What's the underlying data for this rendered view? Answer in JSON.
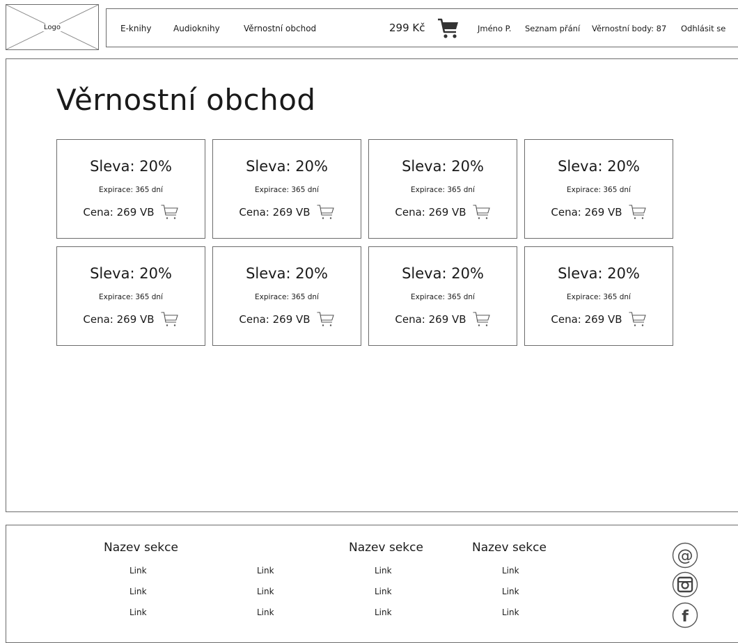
{
  "header": {
    "logo_label": "Logo",
    "nav": [
      "E-knihy",
      "Audioknihy",
      "Věrnostní obchod"
    ],
    "cart_total": "299 Kč",
    "user_name": "Jméno P.",
    "wishlist": "Seznam přání",
    "loyalty_points": "Věrnostní body: 87",
    "logout": "Odhlásit se"
  },
  "main": {
    "title": "Věrnostní obchod",
    "cards": [
      {
        "discount": "Sleva: 20%",
        "expiry": "Expirace: 365 dní",
        "price": "Cena: 269 VB"
      },
      {
        "discount": "Sleva: 20%",
        "expiry": "Expirace: 365 dní",
        "price": "Cena: 269 VB"
      },
      {
        "discount": "Sleva: 20%",
        "expiry": "Expirace: 365 dní",
        "price": "Cena: 269 VB"
      },
      {
        "discount": "Sleva: 20%",
        "expiry": "Expirace: 365 dní",
        "price": "Cena: 269 VB"
      },
      {
        "discount": "Sleva: 20%",
        "expiry": "Expirace: 365 dní",
        "price": "Cena: 269 VB"
      },
      {
        "discount": "Sleva: 20%",
        "expiry": "Expirace: 365 dní",
        "price": "Cena: 269 VB"
      },
      {
        "discount": "Sleva: 20%",
        "expiry": "Expirace: 365 dní",
        "price": "Cena: 269 VB"
      },
      {
        "discount": "Sleva: 20%",
        "expiry": "Expirace: 365 dní",
        "price": "Cena: 269 VB"
      }
    ]
  },
  "footer": {
    "headings": [
      "Nazev sekce",
      "Nazev sekce",
      "Nazev sekce"
    ],
    "columns": [
      [
        "Link",
        "Link",
        "Link"
      ],
      [
        "Link",
        "Link",
        "Link"
      ],
      [
        "Link",
        "Link",
        "Link"
      ],
      [
        "Link",
        "Link",
        "Link"
      ]
    ],
    "social_icons": [
      "email-icon",
      "instagram-icon",
      "facebook-icon"
    ]
  }
}
